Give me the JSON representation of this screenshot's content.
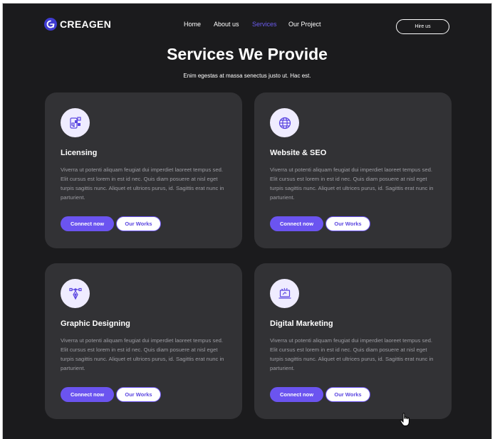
{
  "brand": {
    "name": "CREAGEN",
    "logo_mark": "CR"
  },
  "nav": {
    "items": [
      {
        "label": "Home",
        "active": false
      },
      {
        "label": "About us",
        "active": false
      },
      {
        "label": "Services",
        "active": true
      },
      {
        "label": "Our Project",
        "active": false
      }
    ],
    "hire_label": "Hire us"
  },
  "hero": {
    "title": "Services We Provide",
    "subtitle": "Enim egestas at massa senectus justo ut. Hac est."
  },
  "services": [
    {
      "title": "Licensing",
      "icon": "licensing-icon",
      "description": "Viverra ut potenti aliquam feugiat dui imperdiet laoreet tempus sed. Elit cursus est lorem in est id nec. Quis diam posuere at nisl eget turpis sagittis nunc. Aliquet et ultrices purus, id. Sagittis erat nunc in parturient.",
      "connect_label": "Connect now",
      "works_label": "Our Works"
    },
    {
      "title": "Website & SEO",
      "icon": "globe-icon",
      "description": "Viverra ut potenti aliquam feugiat dui imperdiet laoreet tempus sed. Elit cursus est lorem in est id nec. Quis diam posuere at nisl eget turpis sagittis nunc. Aliquet et ultrices purus, id. Sagittis erat nunc in parturient.",
      "connect_label": "Connect now",
      "works_label": "Our Works"
    },
    {
      "title": "Graphic Designing",
      "icon": "pen-tool-icon",
      "description": "Viverra ut potenti aliquam feugiat dui imperdiet laoreet tempus sed. Elit cursus est lorem in est id nec. Quis diam posuere at nisl eget turpis sagittis nunc. Aliquet et ultrices purus, id. Sagittis erat nunc in parturient.",
      "connect_label": "Connect now",
      "works_label": "Our Works"
    },
    {
      "title": "Digital Marketing",
      "icon": "laptop-marketing-icon",
      "description": "Viverra ut potenti aliquam feugiat dui imperdiet laoreet tempus sed. Elit cursus est lorem in est id nec. Quis diam posuere at nisl eget turpis sagittis nunc. Aliquet et ultrices purus, id. Sagittis erat nunc in parturient.",
      "connect_label": "Connect now",
      "works_label": "Our Works"
    }
  ],
  "colors": {
    "background": "#1b1b1d",
    "card": "#323235",
    "accent": "#6b54f0",
    "nav_active": "#6b5cf0",
    "icon_bg": "#efecff",
    "description_text": "#9c9ca2"
  }
}
